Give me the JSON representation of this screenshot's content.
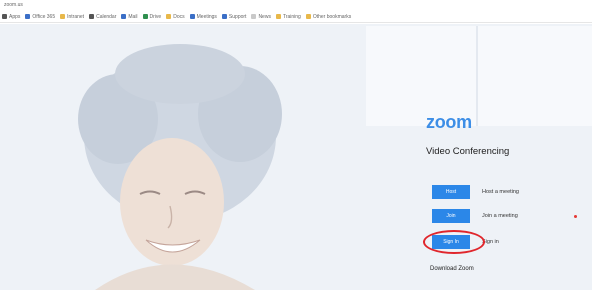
{
  "browser": {
    "address_text": "zoom.us",
    "bookmarks": [
      {
        "label": "Apps",
        "icon": "apps-icon"
      },
      {
        "label": "Office 365",
        "icon": "office-icon"
      },
      {
        "label": "Intranet",
        "icon": "folder-icon"
      },
      {
        "label": "Calendar",
        "icon": "calendar-icon"
      },
      {
        "label": "Mail",
        "icon": "mail-icon"
      },
      {
        "label": "Drive",
        "icon": "drive-icon"
      },
      {
        "label": "Docs",
        "icon": "folder-icon"
      },
      {
        "label": "Meetings",
        "icon": "meeting-icon"
      },
      {
        "label": "Support",
        "icon": "support-icon"
      },
      {
        "label": "News",
        "icon": "news-icon"
      },
      {
        "label": "Training",
        "icon": "folder-icon"
      },
      {
        "label": "Other bookmarks",
        "icon": "folder-icon"
      }
    ]
  },
  "hero": {
    "logo": "zoom",
    "heading": "Video Conferencing",
    "actions": [
      {
        "button": "Host",
        "text": "Host a meeting"
      },
      {
        "button": "Join",
        "text": "Join a meeting"
      },
      {
        "button": "Sign In",
        "text": "Sign in"
      }
    ],
    "footer_link": "Download Zoom"
  },
  "colors": {
    "brand": "#2b87e8",
    "highlight": "#e0262c"
  }
}
